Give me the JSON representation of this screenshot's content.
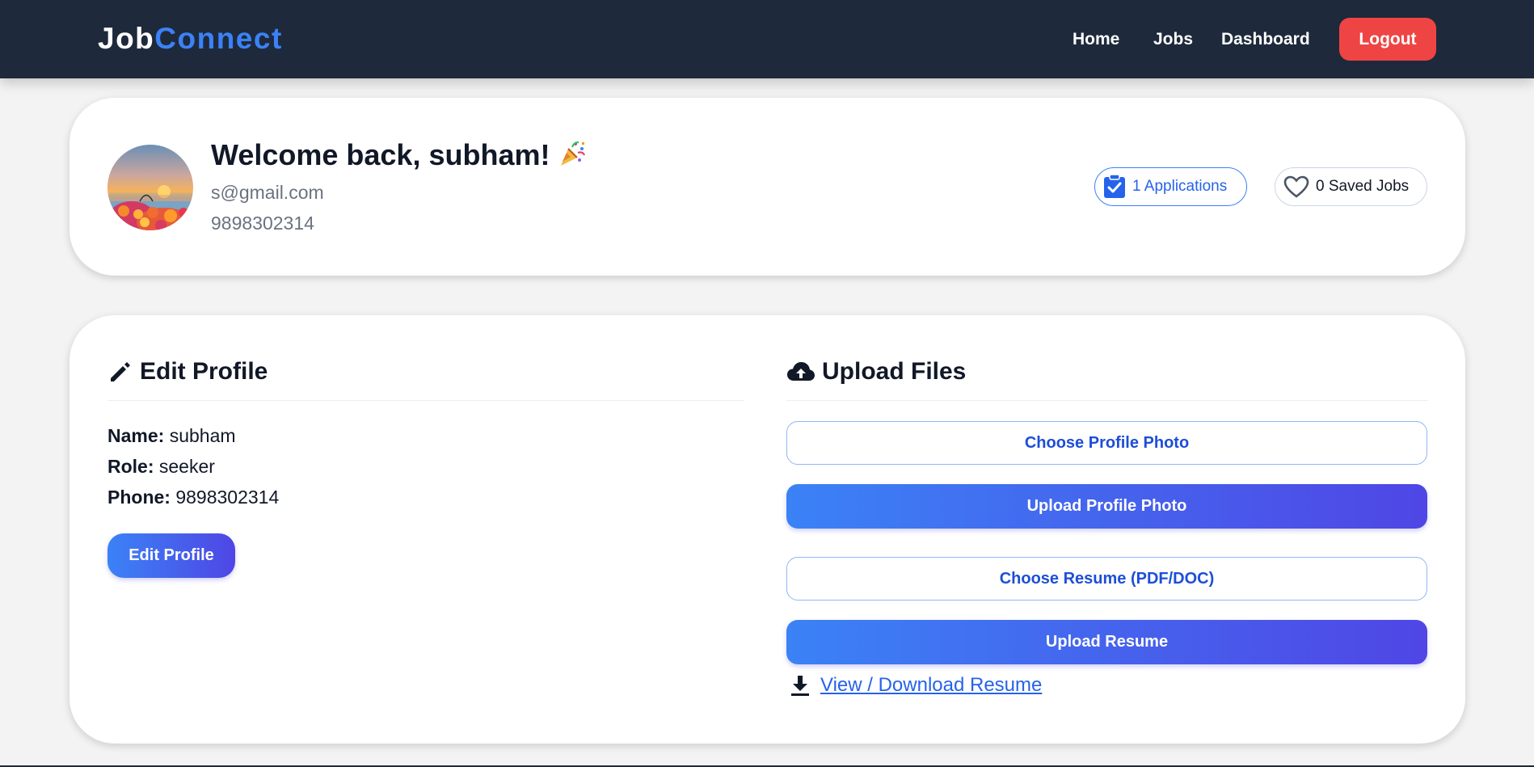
{
  "navbar": {
    "brand_part1": "Job",
    "brand_part2": "Connect",
    "links": [
      "Home",
      "Jobs",
      "Dashboard"
    ],
    "logout_label": "Logout"
  },
  "profile": {
    "welcome": "Welcome back, subham!",
    "email": "s@gmail.com",
    "phone": "9898302314",
    "applications_label": "1 Applications",
    "saved_label": "0 Saved Jobs"
  },
  "edit_section": {
    "title": "Edit Profile",
    "name_label": "Name:",
    "name_value": "subham",
    "role_label": "Role:",
    "role_value": "seeker",
    "phone_label": "Phone:",
    "phone_value": "9898302314",
    "button_label": "Edit Profile"
  },
  "upload_section": {
    "title": "Upload Files",
    "choose_photo_label": "Choose Profile Photo",
    "upload_photo_label": "Upload Profile Photo",
    "choose_resume_label": "Choose Resume (PDF/DOC)",
    "upload_resume_label": "Upload Resume",
    "download_label": "View / Download Resume"
  },
  "colors": {
    "navbar_bg": "#1e293b",
    "brand_accent": "#3b82f6",
    "logout_bg": "#ef4444",
    "gradient_start": "#3b82f6",
    "gradient_end": "#4f46e5",
    "link": "#2563eb"
  },
  "icons": {
    "welcome": "party-popper-icon",
    "applications": "clipboard-check-icon",
    "saved": "heart-icon",
    "edit": "pencil-icon",
    "upload": "cloud-upload-icon",
    "download": "download-icon"
  }
}
